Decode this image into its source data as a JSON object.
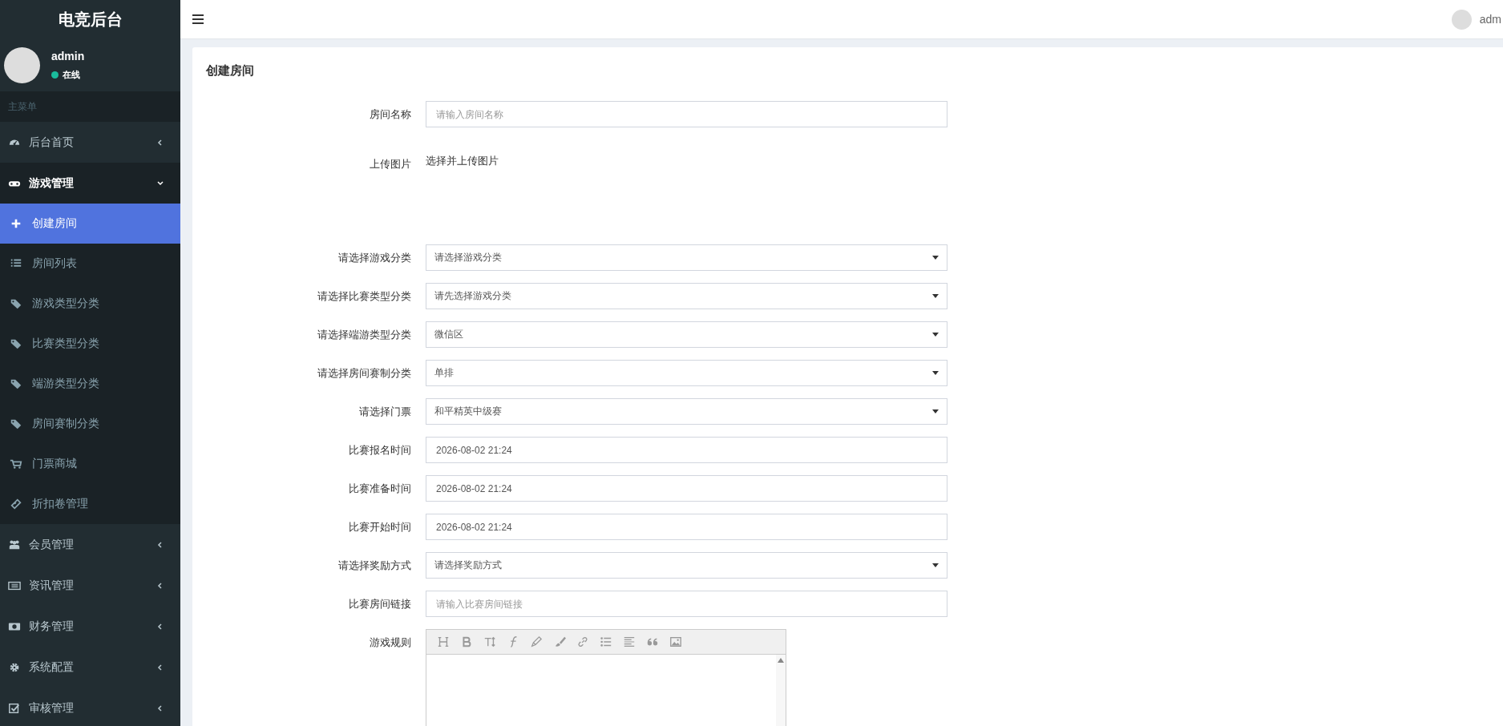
{
  "sidebar": {
    "logo": "电竞后台",
    "user": {
      "name": "admin",
      "status": "在线"
    },
    "menu_header": "主菜单",
    "items": [
      {
        "label": "后台首页",
        "expanded": false
      },
      {
        "label": "游戏管理",
        "expanded": true,
        "children": [
          {
            "label": "创建房间",
            "selected": true
          },
          {
            "label": "房间列表",
            "selected": false
          },
          {
            "label": "游戏类型分类",
            "selected": false
          },
          {
            "label": "比赛类型分类",
            "selected": false
          },
          {
            "label": "端游类型分类",
            "selected": false
          },
          {
            "label": "房间赛制分类",
            "selected": false
          },
          {
            "label": "门票商城",
            "selected": false
          },
          {
            "label": "折扣卷管理",
            "selected": false
          }
        ]
      },
      {
        "label": "会员管理",
        "expanded": false
      },
      {
        "label": "资讯管理",
        "expanded": false
      },
      {
        "label": "财务管理",
        "expanded": false
      },
      {
        "label": "系统配置",
        "expanded": false
      },
      {
        "label": "审核管理",
        "expanded": false
      }
    ]
  },
  "topbar": {
    "user_name": "adm"
  },
  "form": {
    "title": "创建房间",
    "fields": [
      {
        "kind": "text",
        "label": "房间名称",
        "placeholder": "请输入房间名称"
      },
      {
        "kind": "upload",
        "label": "上传图片",
        "link": "选择并上传图片"
      },
      {
        "kind": "select",
        "label": "请选择游戏分类",
        "value": "请选择游戏分类"
      },
      {
        "kind": "select",
        "label": "请选择比赛类型分类",
        "value": "请先选择游戏分类"
      },
      {
        "kind": "select",
        "label": "请选择端游类型分类",
        "value": "微信区"
      },
      {
        "kind": "select",
        "label": "请选择房间赛制分类",
        "value": "单排"
      },
      {
        "kind": "select",
        "label": "请选择门票",
        "value": "和平精英中级赛"
      },
      {
        "kind": "text",
        "label": "比赛报名时间",
        "value": "2026-08-02 21:24"
      },
      {
        "kind": "text",
        "label": "比赛准备时间",
        "value": "2026-08-02 21:24"
      },
      {
        "kind": "text",
        "label": "比赛开始时间",
        "value": "2026-08-02 21:24"
      },
      {
        "kind": "select",
        "label": "请选择奖励方式",
        "value": "请选择奖励方式"
      },
      {
        "kind": "text",
        "label": "比赛房间链接",
        "placeholder": "请输入比赛房间链接"
      },
      {
        "kind": "editor",
        "label": "游戏规则"
      }
    ]
  }
}
